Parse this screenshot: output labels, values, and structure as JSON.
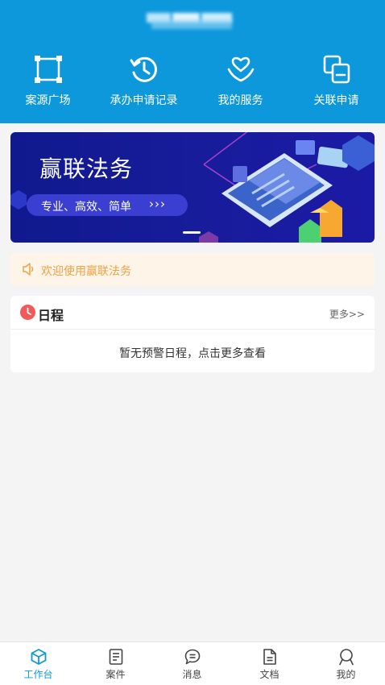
{
  "header": {
    "quick_actions": [
      {
        "label": "案源广场",
        "icon": "crop-frame-icon"
      },
      {
        "label": "承办申请记录",
        "icon": "history-icon"
      },
      {
        "label": "我的服务",
        "icon": "heart-hand-icon"
      },
      {
        "label": "关联申请",
        "icon": "link-copy-icon"
      }
    ]
  },
  "banner": {
    "title": "赢联法务",
    "subtitle": "专业、高效、简单",
    "arrows": "›››"
  },
  "notice": {
    "text": "欢迎使用赢联法务"
  },
  "schedule": {
    "title": "日程",
    "more": "更多>>",
    "empty": "暂无预警日程，点击更多查看"
  },
  "tabbar": {
    "items": [
      {
        "label": "工作台",
        "icon": "cube-icon",
        "active": true
      },
      {
        "label": "案件",
        "icon": "document-list-icon",
        "active": false
      },
      {
        "label": "消息",
        "icon": "chat-bubble-icon",
        "active": false
      },
      {
        "label": "文档",
        "icon": "file-icon",
        "active": false
      },
      {
        "label": "我的",
        "icon": "user-icon",
        "active": false
      }
    ]
  },
  "colors": {
    "primary": "#0d98dc",
    "notice_text": "#f0a244",
    "notice_bg": "#fef4e8",
    "banner_bg": "#171c9a"
  }
}
